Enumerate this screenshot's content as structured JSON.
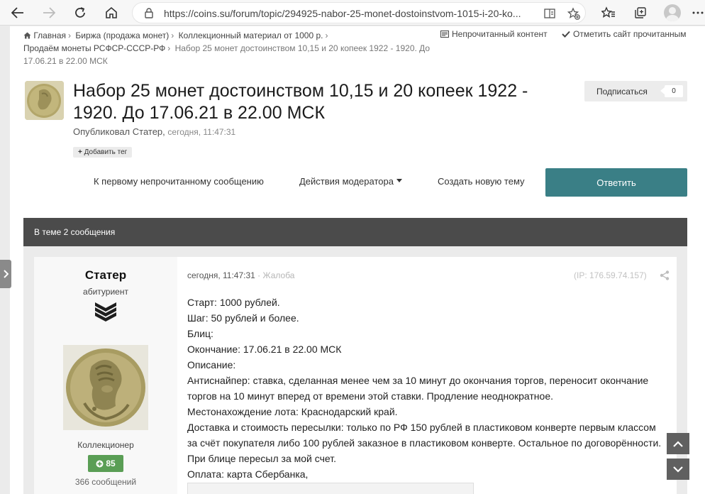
{
  "browser": {
    "url": "https://coins.su/forum/topic/294925-nabor-25-monet-dostoinstvom-1015-i-20-ko..."
  },
  "breadcrumb": {
    "items": [
      "Главная",
      "Биржа (продажа монет)",
      "Коллекционный материал от 1000 р.",
      "Продаём монеты РСФСР-СССР-РФ"
    ],
    "current": "Набор 25 монет достоинством 10,15 и 20 копеек 1922 - 1920. До 17.06.21 в 22.00 МСК"
  },
  "top_links": {
    "unread": "Непрочитанный контент",
    "mark_read": "Отметить сайт прочитанным"
  },
  "topic": {
    "title": "Набор 25 монет достоинством 10,15 и 20 копеек 1922 - 1920. До 17.06.21 в 22.00 МСК",
    "posted_by": "Опубликовал Статер,",
    "posted_time": "сегодня, 11:47:31",
    "add_tag": "Добавить тег"
  },
  "subscribe": {
    "label": "Подписаться",
    "count": "0"
  },
  "actions": {
    "first_unread": "К первому непрочитанному сообщению",
    "moderator": "Действия модератора",
    "new_topic": "Создать новую тему",
    "reply": "Ответить"
  },
  "thread_count": "В теме 2 сообщения",
  "post": {
    "author": {
      "name": "Статер",
      "rank": "абитуриент",
      "group": "Коллекционер",
      "reputation": "85",
      "posts": "366 сообщений"
    },
    "time": "сегодня, 11:47:31",
    "report": "Жалоба",
    "ip": "(IP: 176.59.74.157)",
    "lines": [
      "Старт: 1000 рублей.",
      "Шаг: 50 рублей и более.",
      "Блиц:",
      "Окончание: 17.06.21 в 22.00 МСК",
      "Описание:",
      "Антиснайпер: ставка, сделанная менее чем за 10 минут до окончания торгов, переносит окончание",
      "торгов на 10 минут вперед от времени этой ставки. Продление неоднократное.",
      "Местонахождение лота: Краснодарский край.",
      "Доставка и стоимость пересылки: только по РФ 150 рублей в пластиковом конверте первым классом",
      "за счёт покупателя либо 100 рублей заказное в пластиковом конверте.  Остальное по договорённости.",
      "При блице пересыл за мой счет.",
      "Оплата: карта Сбербанка,"
    ]
  },
  "colors": {
    "reply_button": "#3a7f86",
    "count_bar": "#4b4b4b",
    "reputation": "#5a9e55"
  }
}
